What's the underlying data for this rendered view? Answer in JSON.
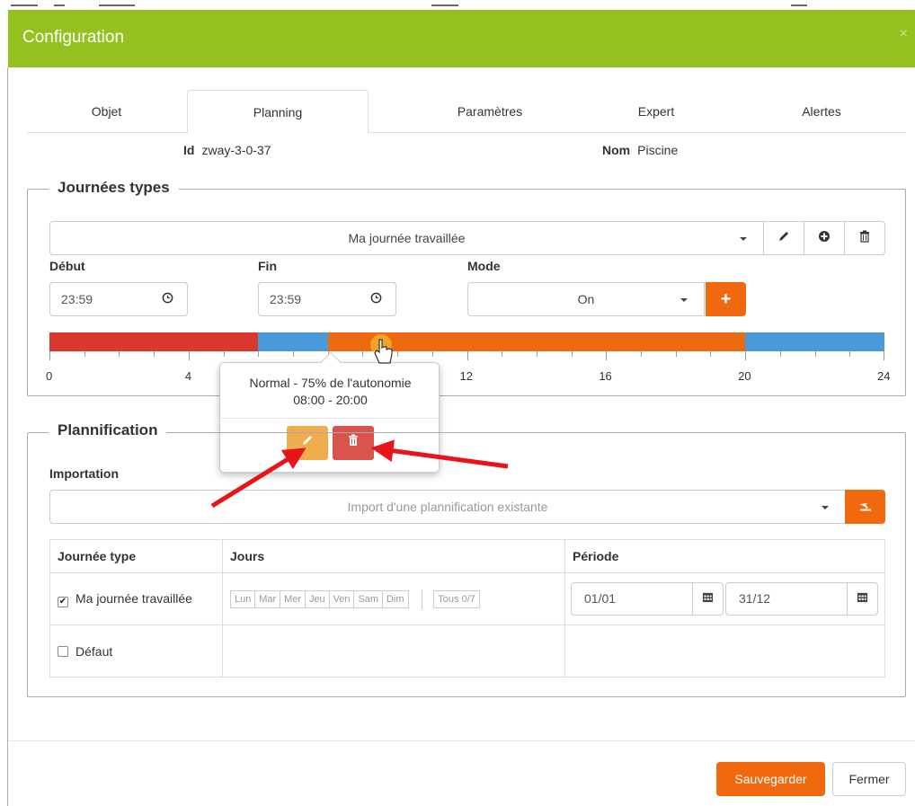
{
  "header": {
    "title": "Configuration",
    "close": "×"
  },
  "tabs": [
    {
      "label": "Objet"
    },
    {
      "label": "Planning"
    },
    {
      "label": "Paramètres"
    },
    {
      "label": "Expert"
    },
    {
      "label": "Alertes"
    }
  ],
  "info": {
    "id_label": "Id",
    "id_value": "zway-3-0-37",
    "name_label": "Nom",
    "name_value": "Piscine"
  },
  "journees": {
    "legend": "Journées types",
    "selected_day": "Ma journée travaillée",
    "debut_label": "Début",
    "debut_value": "23:59",
    "fin_label": "Fin",
    "fin_value": "23:59",
    "mode_label": "Mode",
    "mode_value": "On",
    "add_symbol": "+",
    "timeline": {
      "segments": [
        {
          "from": 0,
          "to": 6,
          "color": "#d9382f"
        },
        {
          "from": 6,
          "to": 8,
          "color": "#4a9ad9"
        },
        {
          "from": 8,
          "to": 20,
          "color": "#ec6b12"
        },
        {
          "from": 20,
          "to": 24,
          "color": "#4a9ad9"
        }
      ],
      "tick_labels": [
        "0",
        "4",
        "8",
        "12",
        "16",
        "20",
        "24"
      ]
    }
  },
  "popover": {
    "line1": "Normal - 75% de l'autonomie",
    "line2": "08:00 - 20:00",
    "edit_color": "#f0ad4e",
    "delete_color": "#d9534f"
  },
  "planification": {
    "legend": "Plannification",
    "import_label": "Importation",
    "import_placeholder": "Import d'une plannification existante",
    "columns": {
      "day_type": "Journée type",
      "days": "Jours",
      "period": "Période"
    },
    "rows": [
      {
        "label": "Ma journée travaillée",
        "checked": true
      },
      {
        "label": "Défaut",
        "checked": false
      }
    ],
    "days": [
      "Lun",
      "Mar",
      "Mer",
      "Jeu",
      "Ven",
      "Sam",
      "Dim"
    ],
    "all_days": "Tous 0/7",
    "period_start": "01/01",
    "period_end": "31/12"
  },
  "footer": {
    "save": "Sauvegarder",
    "close": "Fermer"
  }
}
